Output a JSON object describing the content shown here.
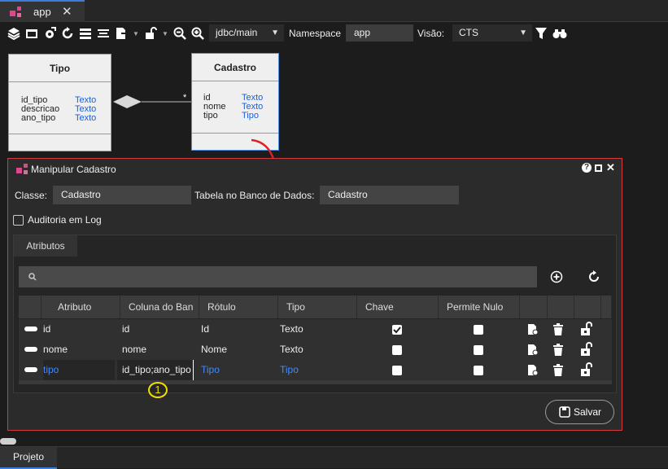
{
  "tabbar": {
    "tab_label": "app"
  },
  "toolbar": {
    "db_select": "jdbc/main",
    "namespace_label": "Namespace",
    "namespace_value": "app",
    "visao_label": "Visão:",
    "visao_value": "CTS"
  },
  "diagram": {
    "entities": [
      {
        "title": "Tipo",
        "attributes": [
          {
            "name": "id_tipo",
            "type": "Texto"
          },
          {
            "name": "descricao",
            "type": "Texto"
          },
          {
            "name": "ano_tipo",
            "type": "Texto"
          }
        ]
      },
      {
        "title": "Cadastro",
        "attributes": [
          {
            "name": "id",
            "type": "Texto"
          },
          {
            "name": "nome",
            "type": "Texto"
          },
          {
            "name": "tipo",
            "type": "Tipo"
          }
        ]
      }
    ],
    "multiplicity": "*"
  },
  "dialog": {
    "title": "Manipular Cadastro",
    "classe_label": "Classe:",
    "classe_value": "Cadastro",
    "tabela_label": "Tabela no Banco de Dados:",
    "tabela_value": "Cadastro",
    "auditoria_label": "Auditoria em Log",
    "attributes_tab": "Atributos",
    "columns": [
      "Atributo",
      "Coluna do Ban",
      "Rótulo",
      "Tipo",
      "Chave",
      "Permite Nulo"
    ],
    "rows": [
      {
        "atributo": "id",
        "coluna": "id",
        "rotulo": "Id",
        "tipo": "Texto",
        "chave": true,
        "permite_nulo": false
      },
      {
        "atributo": "nome",
        "coluna": "nome",
        "rotulo": "Nome",
        "tipo": "Texto",
        "chave": false,
        "permite_nulo": false
      },
      {
        "atributo": "tipo",
        "coluna": "id_tipo;ano_tipo",
        "rotulo": "Tipo",
        "tipo": "Tipo",
        "chave": false,
        "permite_nulo": false
      }
    ],
    "annotation_number": "1",
    "save_label": "Salvar"
  },
  "bottom": {
    "tab_label": "Projeto"
  },
  "colors": {
    "accent": "#3b7ddd",
    "dialog_border": "#d23b3b",
    "link_blue": "#3d8bff",
    "arrow_red": "#e02020",
    "marker_yellow": "#f0e000"
  }
}
